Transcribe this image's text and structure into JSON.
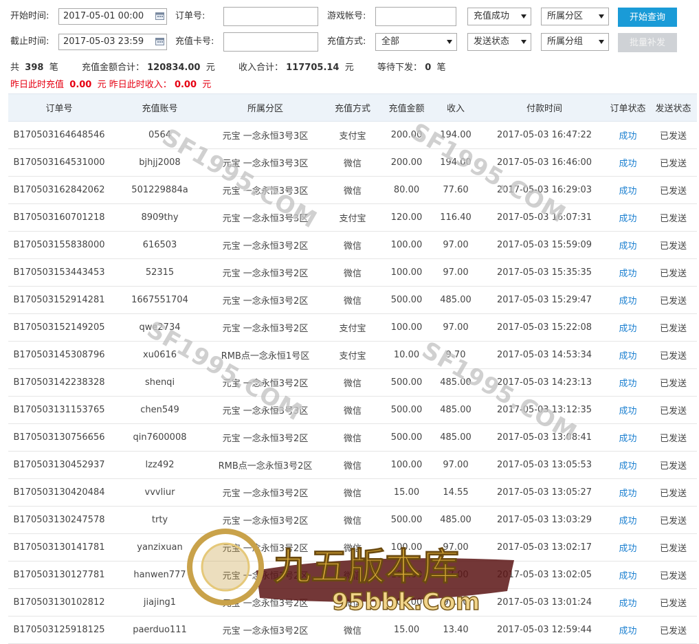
{
  "filters": {
    "start_label": "开始时间:",
    "start_value": "2017-05-01 00:00",
    "end_label": "截止时间:",
    "end_value": "2017-05-03 23:59",
    "order_label": "订单号:",
    "order_value": "",
    "card_label": "充值卡号:",
    "card_value": "",
    "account_label": "游戏帐号:",
    "account_value": "",
    "method_label": "充值方式:",
    "method_selected": "全部",
    "recharge_status_selected": "充值成功",
    "send_status_selected": "发送状态",
    "zone_selected": "所属分区",
    "group_selected": "所属分组",
    "query_button": "开始查询",
    "batch_button": "批量补发"
  },
  "summary": {
    "total_prefix": "共",
    "total_count": "398",
    "total_unit": "笔",
    "recharge_total_label": "充值金额合计：",
    "recharge_total": "120834.00",
    "recharge_unit": "元",
    "income_total_label": "收入合计：",
    "income_total": "117705.14",
    "income_unit": "元",
    "pending_label": "等待下发：",
    "pending_count": "0",
    "pending_unit": "笔",
    "yesterday_recharge_label": "昨日此时充值",
    "yesterday_recharge": "0.00",
    "yesterday_recharge_unit": "元",
    "yesterday_income_label": "昨日此时收入：",
    "yesterday_income": "0.00",
    "yesterday_income_unit": "元"
  },
  "table": {
    "headers": [
      "订单号",
      "充值账号",
      "所属分区",
      "充值方式",
      "充值金额",
      "收入",
      "付款时间",
      "订单状态",
      "发送状态"
    ],
    "rows": [
      [
        "B170503164648546",
        "0564",
        "元宝 一念永恒3号3区",
        "支付宝",
        "200.00",
        "194.00",
        "2017-05-03 16:47:22",
        "成功",
        "已发送"
      ],
      [
        "B170503164531000",
        "bjhjj2008",
        "元宝 一念永恒3号3区",
        "微信",
        "200.00",
        "194.00",
        "2017-05-03 16:46:00",
        "成功",
        "已发送"
      ],
      [
        "B170503162842062",
        "501229884a",
        "元宝 一念永恒3号3区",
        "微信",
        "80.00",
        "77.60",
        "2017-05-03 16:29:03",
        "成功",
        "已发送"
      ],
      [
        "B170503160701218",
        "8909thy",
        "元宝 一念永恒3号3区",
        "支付宝",
        "120.00",
        "116.40",
        "2017-05-03 16:07:31",
        "成功",
        "已发送"
      ],
      [
        "B170503155838000",
        "616503",
        "元宝 一念永恒3号2区",
        "微信",
        "100.00",
        "97.00",
        "2017-05-03 15:59:09",
        "成功",
        "已发送"
      ],
      [
        "B170503153443453",
        "52315",
        "元宝 一念永恒3号2区",
        "微信",
        "100.00",
        "97.00",
        "2017-05-03 15:35:35",
        "成功",
        "已发送"
      ],
      [
        "B170503152914281",
        "1667551704",
        "元宝 一念永恒3号2区",
        "微信",
        "500.00",
        "485.00",
        "2017-05-03 15:29:47",
        "成功",
        "已发送"
      ],
      [
        "B170503152149205",
        "qwe2734",
        "元宝 一念永恒3号2区",
        "支付宝",
        "100.00",
        "97.00",
        "2017-05-03 15:22:08",
        "成功",
        "已发送"
      ],
      [
        "B170503145308796",
        "xu0616",
        "RMB点一念永恒1号区",
        "支付宝",
        "10.00",
        "9.70",
        "2017-05-03 14:53:34",
        "成功",
        "已发送"
      ],
      [
        "B170503142238328",
        "shenqi",
        "元宝 一念永恒3号2区",
        "微信",
        "500.00",
        "485.00",
        "2017-05-03 14:23:13",
        "成功",
        "已发送"
      ],
      [
        "B170503131153765",
        "chen549",
        "元宝 一念永恒3号3区",
        "微信",
        "500.00",
        "485.00",
        "2017-05-03 13:12:35",
        "成功",
        "已发送"
      ],
      [
        "B170503130756656",
        "qin7600008",
        "元宝 一念永恒3号2区",
        "微信",
        "500.00",
        "485.00",
        "2017-05-03 13:08:41",
        "成功",
        "已发送"
      ],
      [
        "B170503130452937",
        "lzz492",
        "RMB点一念永恒3号2区",
        "微信",
        "100.00",
        "97.00",
        "2017-05-03 13:05:53",
        "成功",
        "已发送"
      ],
      [
        "B170503130420484",
        "vvvliur",
        "元宝 一念永恒3号2区",
        "微信",
        "15.00",
        "14.55",
        "2017-05-03 13:05:27",
        "成功",
        "已发送"
      ],
      [
        "B170503130247578",
        "trty",
        "元宝 一念永恒3号2区",
        "微信",
        "500.00",
        "485.00",
        "2017-05-03 13:03:29",
        "成功",
        "已发送"
      ],
      [
        "B170503130141781",
        "yanzixuan",
        "元宝 一念永恒3号2区",
        "微信",
        "100.00",
        "97.00",
        "2017-05-03 13:02:17",
        "成功",
        "已发送"
      ],
      [
        "B170503130127781",
        "hanwen777",
        "元宝 一念永恒3号2区",
        "微信",
        "100.00",
        "97.00",
        "2017-05-03 13:02:05",
        "成功",
        "已发送"
      ],
      [
        "B170503130102812",
        "jiajing1",
        "元宝 一念永恒3号2区",
        "微信",
        "100.00",
        "97.00",
        "2017-05-03 13:01:24",
        "成功",
        "已发送"
      ],
      [
        "B170503125918125",
        "paerduo111",
        "元宝 一念永恒3号2区",
        "微信",
        "15.00",
        "13.40",
        "2017-05-03 12:59:44",
        "成功",
        "已发送"
      ]
    ]
  },
  "watermarks": {
    "site_a": "SF1995.COM",
    "site_b": "95bbk.Com",
    "brand": "九五版本库"
  },
  "colors": {
    "primary": "#1a9bd7",
    "header_bg": "#edf3f9",
    "alert_red": "#e60012",
    "status_link": "#1a7fd0"
  }
}
